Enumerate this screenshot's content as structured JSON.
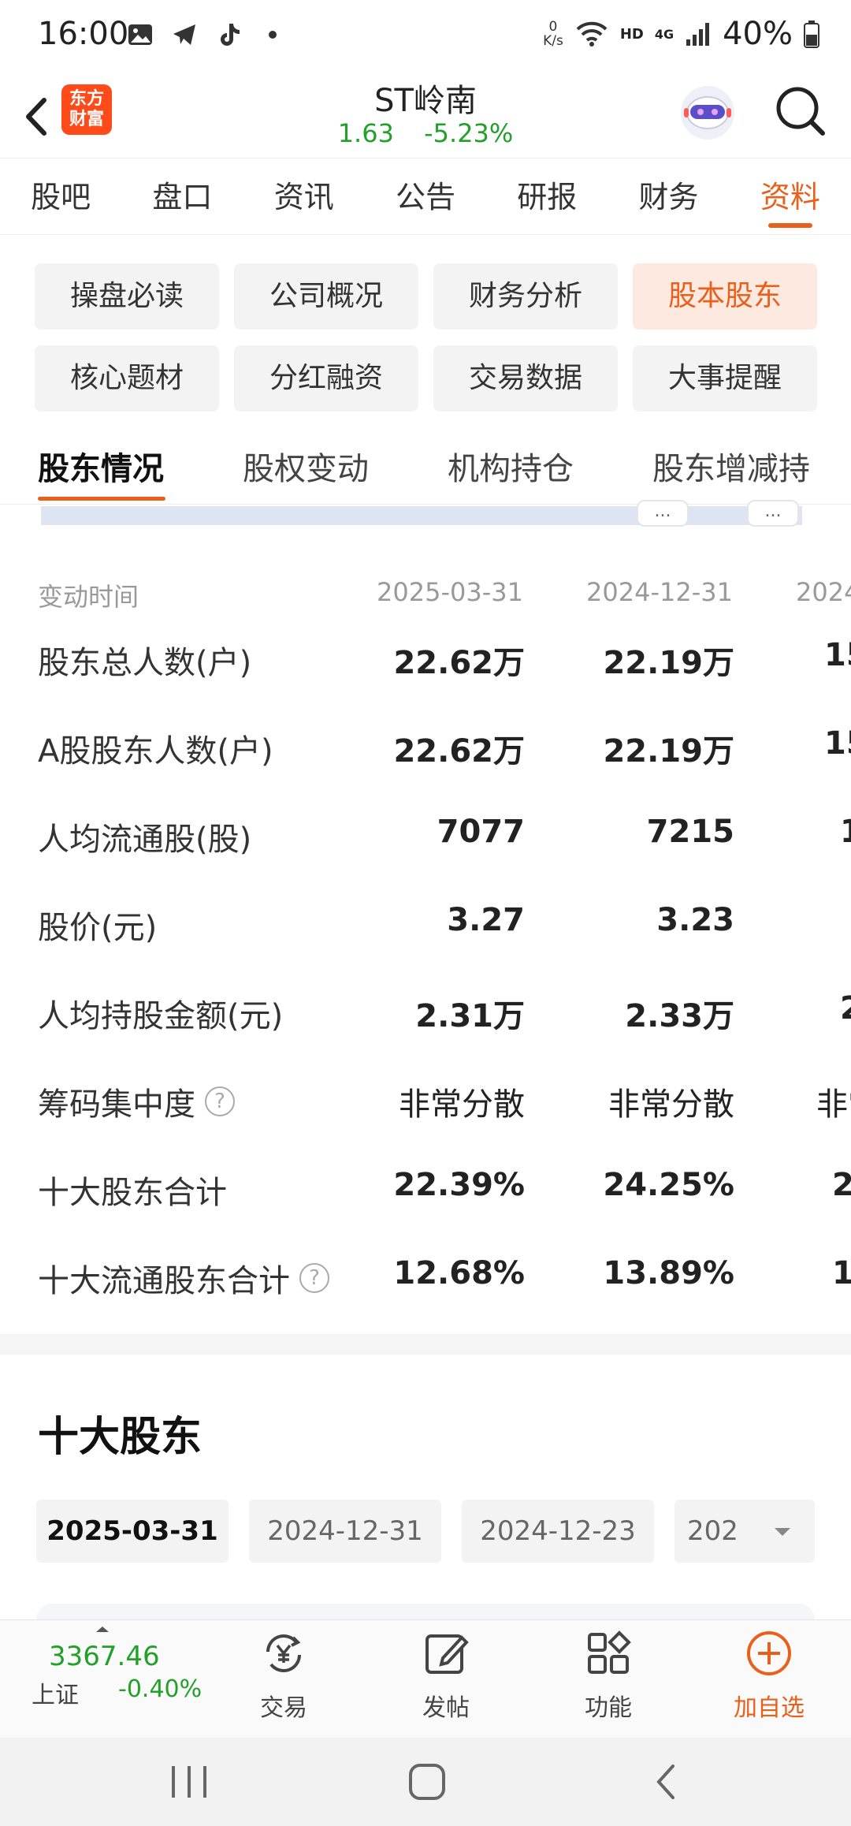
{
  "status_bar": {
    "time": "16:00",
    "speed_top": "0",
    "speed_unit": "K/s",
    "hd": "HD",
    "net": "4G",
    "battery": "40%"
  },
  "header": {
    "logo_text": "东方财富",
    "title": "ST岭南",
    "price": "1.63",
    "change": "-5.23%",
    "price_color": "#22a02a"
  },
  "main_tabs": [
    "股吧",
    "盘口",
    "资讯",
    "公告",
    "研报",
    "财务",
    "资料"
  ],
  "active_main_tab": "资料",
  "chips": [
    "操盘必读",
    "公司概况",
    "财务分析",
    "股本股东",
    "核心题材",
    "分红融资",
    "交易数据",
    "大事提醒"
  ],
  "active_chip": "股本股东",
  "sub_tabs": [
    "股东情况",
    "股权变动",
    "机构持仓",
    "股东增减持"
  ],
  "chart_buttons": [
    "...",
    "..."
  ],
  "table": {
    "header_label": "变动时间",
    "columns": [
      "2025-03-31",
      "2024-12-31",
      "2024"
    ],
    "rows": [
      {
        "label": "股东总人数(户)",
        "values": [
          "22.62万",
          "22.19万",
          "15"
        ],
        "help": false
      },
      {
        "label": "A股股东人数(户)",
        "values": [
          "22.62万",
          "22.19万",
          "15"
        ],
        "help": false
      },
      {
        "label": "人均流通股(股)",
        "values": [
          "7077",
          "7215",
          "1"
        ],
        "help": false
      },
      {
        "label": "股价(元)",
        "values": [
          "3.27",
          "3.23",
          ""
        ],
        "help": false
      },
      {
        "label": "人均持股金额(元)",
        "values": [
          "2.31万",
          "2.33万",
          "2"
        ],
        "help": false
      },
      {
        "label": "筹码集中度",
        "values": [
          "非常分散",
          "非常分散",
          "非常"
        ],
        "help": true
      },
      {
        "label": "十大股东合计",
        "values": [
          "22.39%",
          "24.25%",
          "2"
        ],
        "help": false
      },
      {
        "label": "十大流通股东合计",
        "values": [
          "12.68%",
          "13.89%",
          "1"
        ],
        "help": true
      }
    ],
    "help_glyph": "?"
  },
  "top10": {
    "title": "十大股东",
    "dates": [
      "2025-03-31",
      "2024-12-31",
      "2024-12-23",
      "202"
    ],
    "active_date": "2025-03-31"
  },
  "bottom_bar": {
    "index_value": "3367.46",
    "index_name": "上证",
    "index_change": "-0.40%",
    "nav": [
      {
        "label": "交易",
        "icon": "yuan-exchange-icon"
      },
      {
        "label": "发帖",
        "icon": "edit-post-icon"
      },
      {
        "label": "功能",
        "icon": "grid-functions-icon"
      },
      {
        "label": "加自选",
        "icon": "add-circle-icon"
      }
    ]
  },
  "colors": {
    "accent": "#e8601c",
    "down_green": "#22a02a",
    "chip_bg": "#f3f3f3"
  }
}
